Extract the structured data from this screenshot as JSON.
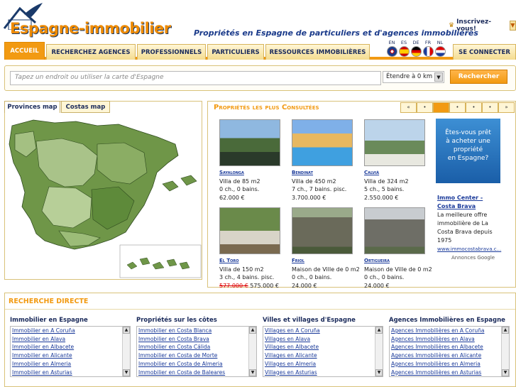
{
  "header": {
    "logo_text": "Espagne-immobilier",
    "tagline": "Propriétés en Espagne de particuliers et d'agences immobilières",
    "signup_label": "Inscrivez-vous!"
  },
  "nav": {
    "tabs": [
      "ACCUEIL",
      "RECHERCHEZ AGENCES",
      "PROFESSIONNELS",
      "PARTICULIERS",
      "RESSOURCES IMMOBILIÈRES"
    ],
    "login": "SE CONNECTER"
  },
  "languages": [
    "EN",
    "ES",
    "DE",
    "FR",
    "NL"
  ],
  "search": {
    "placeholder": "Tapez un endroit ou utiliser la carte d'Espagne",
    "extent": "Étendre à 0 km",
    "button": "Rechercher"
  },
  "map": {
    "tabs": [
      "Provinces map",
      "Costas map"
    ]
  },
  "properties": {
    "title": "Propriétés les plus Consultées",
    "pager": [
      "«",
      "•",
      "•",
      "•",
      "•",
      "•",
      "»"
    ],
    "items": [
      {
        "name": "Sayalonga",
        "type": "Villa de 85 m2",
        "rooms": "0 ch., 0 bains.",
        "price": "62.000 €",
        "old_price": ""
      },
      {
        "name": "Bendinat",
        "type": "Villa de 450 m2",
        "rooms": "7 ch., 7 bains. pisc.",
        "price": "3.700.000 €",
        "old_price": ""
      },
      {
        "name": "Calvià",
        "type": "Villa de 324 m2",
        "rooms": "5 ch., 5 bains.",
        "price": "2.550.000 €",
        "old_price": ""
      },
      {
        "name": "El Toro",
        "type": "Villa de 150 m2",
        "rooms": "3 ch., 4 bains. pisc.",
        "price": "575.000 €",
        "old_price": "577.000 €"
      },
      {
        "name": "Friol",
        "type": "Maison de Ville de 0 m2",
        "rooms": "0 ch., 0 bains.",
        "price": "24.000 €",
        "old_price": ""
      },
      {
        "name": "Ortigueira",
        "type": "Maison de Ville de 0 m2",
        "rooms": "0 ch., 0 bains.",
        "price": "24.000 €",
        "old_price": ""
      }
    ]
  },
  "ad": {
    "banner": [
      "Êtes-vous prêt",
      "à acheter une",
      "propriété",
      "en Espagne?"
    ],
    "title": "Immo Center - Costa Brava",
    "text": "La meilleure offre immobilière de La Costa Brava depuis 1975",
    "url": "www.immocostabrava.c...",
    "label": "Annonces Google"
  },
  "directe": {
    "title": "RECHERCHE DIRECTE",
    "columns": [
      {
        "heading": "Immobilier en Espagne",
        "links": [
          "Immobilier en A Coruña",
          "Immobilier en Alava",
          "Immobilier en Albacete",
          "Immobilier en Alicante",
          "Immobilier en Almeria",
          "Immobilier en Asturias"
        ]
      },
      {
        "heading": "Propriétés sur les côtes",
        "links": [
          "Immobilier en Costa Blanca",
          "Immobilier en Costa Brava",
          "Immobilier en Costa Cálida",
          "Immobilier en Costa de Morte",
          "Immobilier en Costa de Almeria",
          "Immobilier en Costa de Baleares"
        ]
      },
      {
        "heading": "Villes et villages d'Espagne",
        "links": [
          "Villages en A Coruña",
          "Villages en Alava",
          "Villages en Albacete",
          "Villages en Alicante",
          "Villages en Almeria",
          "Villages en Asturias"
        ]
      },
      {
        "heading": "Agences Immobilières en Espagne",
        "links": [
          "Agences Immobilières en A Coruña",
          "Agences Immobilières en Alava",
          "Agences Immobilières en Albacete",
          "Agences Immobilières en Alicante",
          "Agences Immobilières en Almeria",
          "Agences Immobilières en Asturias"
        ]
      }
    ]
  }
}
